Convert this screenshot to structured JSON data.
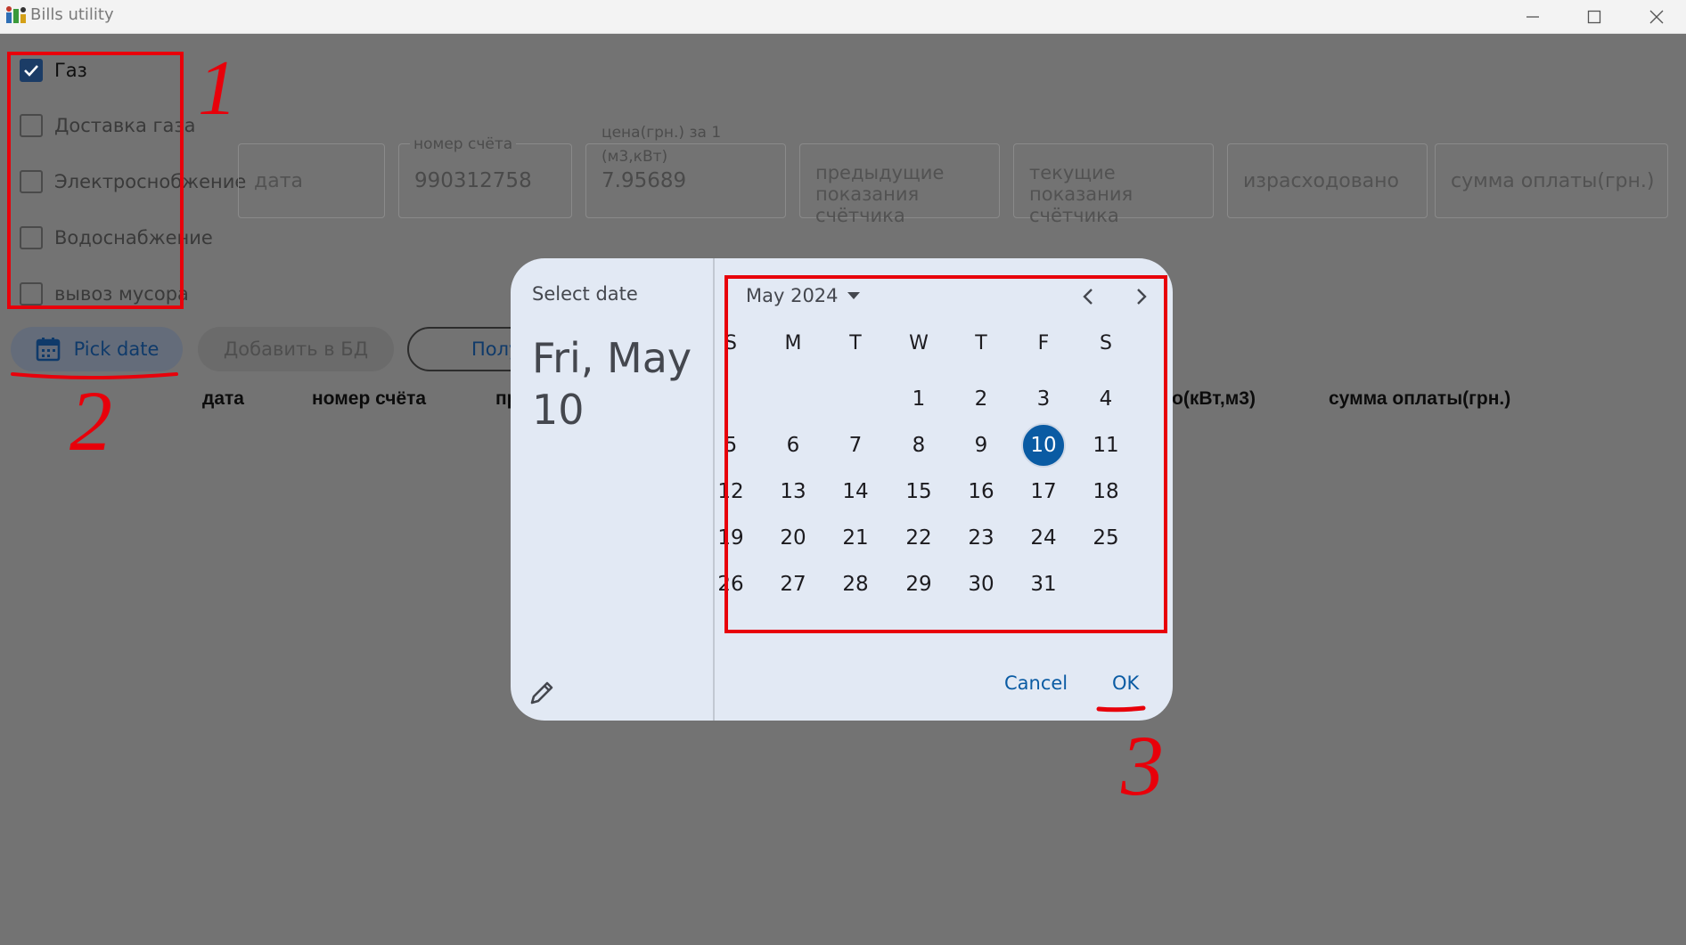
{
  "window": {
    "title": "Bills utility"
  },
  "services": [
    {
      "label": "Газ",
      "checked": true
    },
    {
      "label": "Доставка газа",
      "checked": false
    },
    {
      "label": "Электроснобжение",
      "checked": false
    },
    {
      "label": "Водоснабжение",
      "checked": false
    },
    {
      "label": "вывоз мусора",
      "checked": false
    }
  ],
  "form": {
    "date_placeholder": "дата",
    "account_label": "номер счёта",
    "account_value": "990312758",
    "price_label_1": "цена(грн.) за 1",
    "price_label_2": "(м3,кВт)",
    "price_value": "7.95689",
    "prev_1": "предыдущие",
    "prev_2": "показания",
    "prev_3": "счётчика",
    "curr_1": "текущие",
    "curr_2": "показания",
    "curr_3": "счётчика",
    "used_placeholder": "израсходовано",
    "sum_placeholder": "сумма оплаты(грн.)"
  },
  "actions": {
    "pick_date": "Pick date",
    "add_db": "Добавить в БД",
    "get_partial": "Полу"
  },
  "table_headers": {
    "date": "дата",
    "account": "номер счёта",
    "partial_pr": "пр",
    "partial_used": "о(кВт,м3)",
    "sum": "сумма оплаты(грн.)"
  },
  "dialog": {
    "title": "Select date",
    "heading_line1": "Fri, May",
    "heading_line2": "10",
    "month_label": "May 2024",
    "weekdays": [
      "S",
      "M",
      "T",
      "W",
      "T",
      "F",
      "S"
    ],
    "first_weekday_index": 3,
    "days_in_month": 31,
    "selected_day": 10,
    "cancel": "Cancel",
    "ok": "OK"
  },
  "annotations": {
    "one": "1",
    "two": "2",
    "three": "3"
  },
  "colors": {
    "accent": "#0a5ba3",
    "annotation": "#e8000a",
    "scrim": "#737373"
  }
}
